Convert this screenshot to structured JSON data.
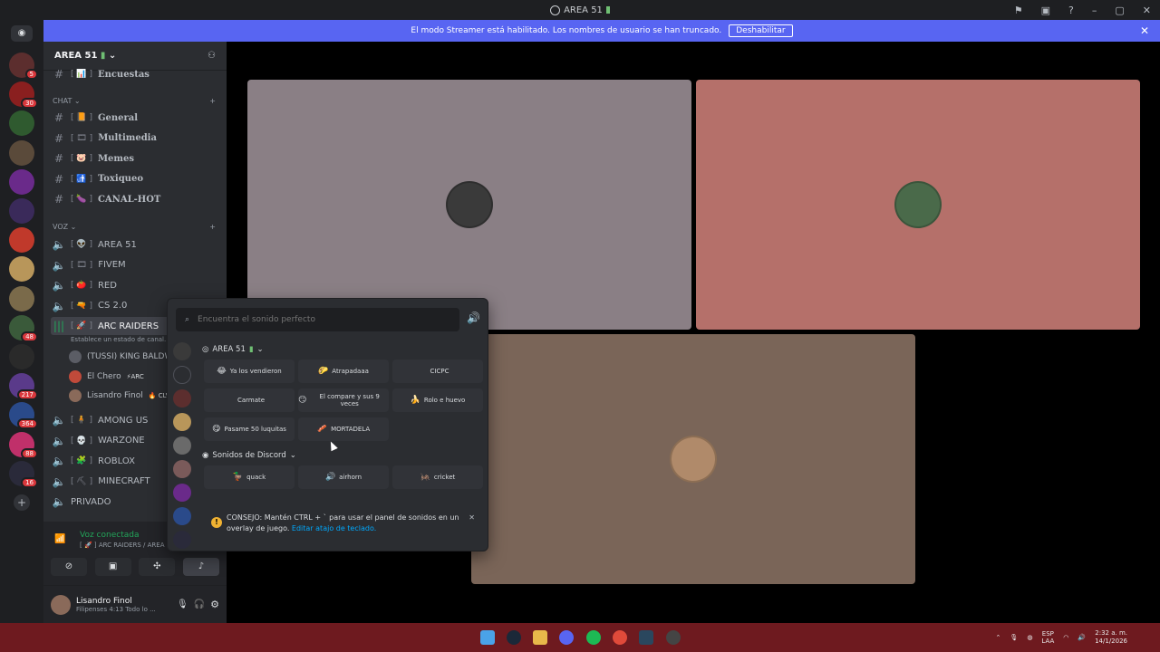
{
  "titlebar": {
    "title": "AREA 51"
  },
  "banner": {
    "message": "El modo Streamer está habilitado. Los nombres de usuario se han truncado.",
    "disable_button": "Deshabilitar"
  },
  "servers": [
    {
      "badge": "5",
      "color": "#5c2e2e"
    },
    {
      "badge": "30",
      "color": "#8a1f1f"
    },
    {
      "badge": "",
      "color": "#2f5a2f"
    },
    {
      "badge": "",
      "color": "#5a4a3a"
    },
    {
      "badge": "",
      "color": "#6a2a8a"
    },
    {
      "badge": "",
      "color": "#3a2a5a"
    },
    {
      "badge": "",
      "color": "#c0392b"
    },
    {
      "badge": "",
      "color": "#b8965a"
    },
    {
      "badge": "",
      "color": "#7a6a4a"
    },
    {
      "badge": "48",
      "color": "#3a5a3a"
    },
    {
      "badge": "",
      "color": "#2a2a2a"
    },
    {
      "badge": "217",
      "color": "#5a3a8a"
    },
    {
      "badge": "364",
      "color": "#2a4a8a"
    },
    {
      "badge": "88",
      "color": "#c0306a"
    },
    {
      "badge": "16",
      "color": "#2a2a3a"
    }
  ],
  "sidebar": {
    "server_name": "AREA 51",
    "top_channel": "Encuestas",
    "chat_category": "CHAT",
    "text_channels": [
      {
        "emoji": "📙",
        "name": "General"
      },
      {
        "emoji": "🎞",
        "name": "Multimedia"
      },
      {
        "emoji": "🐷",
        "name": "Memes"
      },
      {
        "emoji": "🚮",
        "name": "Toxiqueo"
      },
      {
        "emoji": "🍆",
        "name": "CANAL-HOT"
      }
    ],
    "voice_category": "VOZ",
    "voice_channels_top": [
      {
        "emoji": "👽",
        "name": "AREA 51"
      },
      {
        "emoji": "🎞",
        "name": "FIVEM"
      },
      {
        "emoji": "🍅",
        "name": "RED"
      },
      {
        "emoji": "🔫",
        "name": "CS 2.0"
      }
    ],
    "active_channel": {
      "emoji": "🚀",
      "name": "ARC RAIDERS",
      "status": "Establece un estado de canal..."
    },
    "members": [
      {
        "name": "(TUSSI) KING BALDW",
        "tag": ""
      },
      {
        "name": "El Chero",
        "tag": "⚡ARC"
      },
      {
        "name": "Lisandro Finol",
        "tag": "🔥 CLV"
      }
    ],
    "voice_channels_bottom": [
      {
        "emoji": "🧍",
        "name": "AMONG US"
      },
      {
        "emoji": "💀",
        "name": "WARZONE"
      },
      {
        "emoji": "🧩",
        "name": "ROBLOX"
      },
      {
        "emoji": "⛏",
        "name": "MINECRAFT"
      }
    ],
    "private_channel": "PRIVADO"
  },
  "voice_connection": {
    "status": "Voz conectada",
    "location": "ARC RAIDERS / AREA 51"
  },
  "user": {
    "name": "Lisandro Finol",
    "activity": "Filipenses 4:13 Todo lo ..."
  },
  "soundboard": {
    "search_placeholder": "Encuentra el sonido perfecto",
    "server_section": "AREA 51",
    "server_sounds": [
      {
        "emoji": "😂",
        "label": "Ya los vendieron"
      },
      {
        "emoji": "🌮",
        "label": "Atrapadaaa"
      },
      {
        "emoji": "",
        "label": "CICPC"
      },
      {
        "emoji": "",
        "label": "Carmate"
      },
      {
        "emoji": "😏",
        "label": "El compare y sus 9 veces"
      },
      {
        "emoji": "🍌",
        "label": "Rolo e huevo"
      },
      {
        "emoji": "😋",
        "label": "Pasame 50 luquitas"
      },
      {
        "emoji": "🥓",
        "label": "MORTADELA"
      }
    ],
    "discord_section": "Sonidos de Discord",
    "discord_sounds": [
      {
        "emoji": "🦆",
        "label": "quack"
      },
      {
        "emoji": "🔊",
        "label": "airhorn"
      },
      {
        "emoji": "🦗",
        "label": "cricket"
      }
    ],
    "tip_text": "CONSEJO: Mantén CTRL + ` para usar el panel de sonidos en un overlay de juego.",
    "tip_link": "Editar atajo de teclado."
  },
  "stage": {
    "tiles": [
      {
        "bg": "#8a7f85"
      },
      {
        "bg": "#b5706a"
      },
      {
        "bg": "#7a6558"
      }
    ]
  },
  "taskbar": {
    "lang": "ESP",
    "region": "LAA",
    "time": "2:32 a. m.",
    "date": "14/1/2026"
  }
}
